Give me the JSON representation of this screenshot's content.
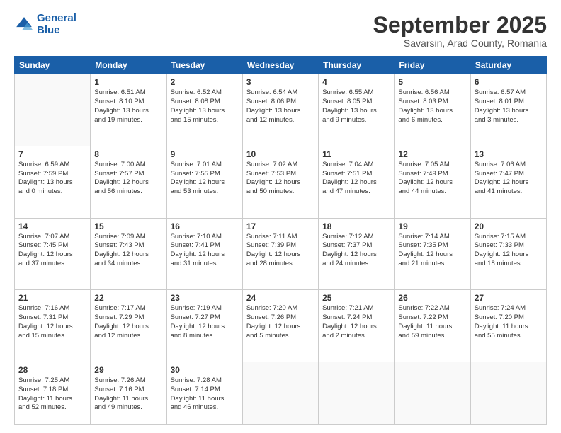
{
  "header": {
    "logo_line1": "General",
    "logo_line2": "Blue",
    "month_title": "September 2025",
    "subtitle": "Savarsin, Arad County, Romania"
  },
  "weekdays": [
    "Sunday",
    "Monday",
    "Tuesday",
    "Wednesday",
    "Thursday",
    "Friday",
    "Saturday"
  ],
  "weeks": [
    [
      {
        "day": "",
        "info": ""
      },
      {
        "day": "1",
        "info": "Sunrise: 6:51 AM\nSunset: 8:10 PM\nDaylight: 13 hours\nand 19 minutes."
      },
      {
        "day": "2",
        "info": "Sunrise: 6:52 AM\nSunset: 8:08 PM\nDaylight: 13 hours\nand 15 minutes."
      },
      {
        "day": "3",
        "info": "Sunrise: 6:54 AM\nSunset: 8:06 PM\nDaylight: 13 hours\nand 12 minutes."
      },
      {
        "day": "4",
        "info": "Sunrise: 6:55 AM\nSunset: 8:05 PM\nDaylight: 13 hours\nand 9 minutes."
      },
      {
        "day": "5",
        "info": "Sunrise: 6:56 AM\nSunset: 8:03 PM\nDaylight: 13 hours\nand 6 minutes."
      },
      {
        "day": "6",
        "info": "Sunrise: 6:57 AM\nSunset: 8:01 PM\nDaylight: 13 hours\nand 3 minutes."
      }
    ],
    [
      {
        "day": "7",
        "info": "Sunrise: 6:59 AM\nSunset: 7:59 PM\nDaylight: 13 hours\nand 0 minutes."
      },
      {
        "day": "8",
        "info": "Sunrise: 7:00 AM\nSunset: 7:57 PM\nDaylight: 12 hours\nand 56 minutes."
      },
      {
        "day": "9",
        "info": "Sunrise: 7:01 AM\nSunset: 7:55 PM\nDaylight: 12 hours\nand 53 minutes."
      },
      {
        "day": "10",
        "info": "Sunrise: 7:02 AM\nSunset: 7:53 PM\nDaylight: 12 hours\nand 50 minutes."
      },
      {
        "day": "11",
        "info": "Sunrise: 7:04 AM\nSunset: 7:51 PM\nDaylight: 12 hours\nand 47 minutes."
      },
      {
        "day": "12",
        "info": "Sunrise: 7:05 AM\nSunset: 7:49 PM\nDaylight: 12 hours\nand 44 minutes."
      },
      {
        "day": "13",
        "info": "Sunrise: 7:06 AM\nSunset: 7:47 PM\nDaylight: 12 hours\nand 41 minutes."
      }
    ],
    [
      {
        "day": "14",
        "info": "Sunrise: 7:07 AM\nSunset: 7:45 PM\nDaylight: 12 hours\nand 37 minutes."
      },
      {
        "day": "15",
        "info": "Sunrise: 7:09 AM\nSunset: 7:43 PM\nDaylight: 12 hours\nand 34 minutes."
      },
      {
        "day": "16",
        "info": "Sunrise: 7:10 AM\nSunset: 7:41 PM\nDaylight: 12 hours\nand 31 minutes."
      },
      {
        "day": "17",
        "info": "Sunrise: 7:11 AM\nSunset: 7:39 PM\nDaylight: 12 hours\nand 28 minutes."
      },
      {
        "day": "18",
        "info": "Sunrise: 7:12 AM\nSunset: 7:37 PM\nDaylight: 12 hours\nand 24 minutes."
      },
      {
        "day": "19",
        "info": "Sunrise: 7:14 AM\nSunset: 7:35 PM\nDaylight: 12 hours\nand 21 minutes."
      },
      {
        "day": "20",
        "info": "Sunrise: 7:15 AM\nSunset: 7:33 PM\nDaylight: 12 hours\nand 18 minutes."
      }
    ],
    [
      {
        "day": "21",
        "info": "Sunrise: 7:16 AM\nSunset: 7:31 PM\nDaylight: 12 hours\nand 15 minutes."
      },
      {
        "day": "22",
        "info": "Sunrise: 7:17 AM\nSunset: 7:29 PM\nDaylight: 12 hours\nand 12 minutes."
      },
      {
        "day": "23",
        "info": "Sunrise: 7:19 AM\nSunset: 7:27 PM\nDaylight: 12 hours\nand 8 minutes."
      },
      {
        "day": "24",
        "info": "Sunrise: 7:20 AM\nSunset: 7:26 PM\nDaylight: 12 hours\nand 5 minutes."
      },
      {
        "day": "25",
        "info": "Sunrise: 7:21 AM\nSunset: 7:24 PM\nDaylight: 12 hours\nand 2 minutes."
      },
      {
        "day": "26",
        "info": "Sunrise: 7:22 AM\nSunset: 7:22 PM\nDaylight: 11 hours\nand 59 minutes."
      },
      {
        "day": "27",
        "info": "Sunrise: 7:24 AM\nSunset: 7:20 PM\nDaylight: 11 hours\nand 55 minutes."
      }
    ],
    [
      {
        "day": "28",
        "info": "Sunrise: 7:25 AM\nSunset: 7:18 PM\nDaylight: 11 hours\nand 52 minutes."
      },
      {
        "day": "29",
        "info": "Sunrise: 7:26 AM\nSunset: 7:16 PM\nDaylight: 11 hours\nand 49 minutes."
      },
      {
        "day": "30",
        "info": "Sunrise: 7:28 AM\nSunset: 7:14 PM\nDaylight: 11 hours\nand 46 minutes."
      },
      {
        "day": "",
        "info": ""
      },
      {
        "day": "",
        "info": ""
      },
      {
        "day": "",
        "info": ""
      },
      {
        "day": "",
        "info": ""
      }
    ]
  ]
}
